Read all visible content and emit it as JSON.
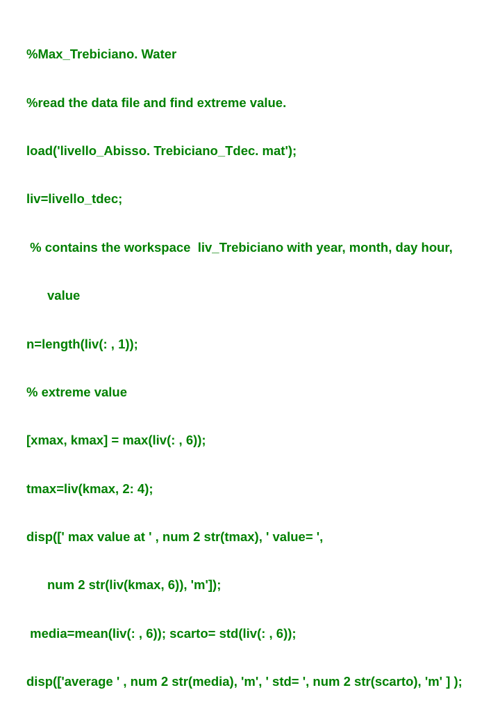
{
  "code": {
    "l01": "%Max_Trebiciano. Water",
    "l02": "%read the data file and find extreme value.",
    "l03": "load('livello_Abisso. Trebiciano_Tdec. mat');",
    "l04": "liv=livello_tdec;",
    "l05": " % contains the workspace  liv_Trebiciano with year, month, day hour,",
    "l05c": "value",
    "l06": "n=length(liv(: , 1));",
    "l07": "% extreme value",
    "l08": "[xmax, kmax] = max(liv(: , 6));",
    "l09": "tmax=liv(kmax, 2: 4);",
    "l10": "disp([' max value at ' , num 2 str(tmax), ' value= ',",
    "l10c": "num 2 str(liv(kmax, 6)), 'm']);",
    "l11": " media=mean(liv(: , 6)); scarto= std(liv(: , 6));",
    "l12": "disp(['average ' , num 2 str(media), 'm', ' std= ', num 2 str(scarto), 'm' ] );"
  }
}
